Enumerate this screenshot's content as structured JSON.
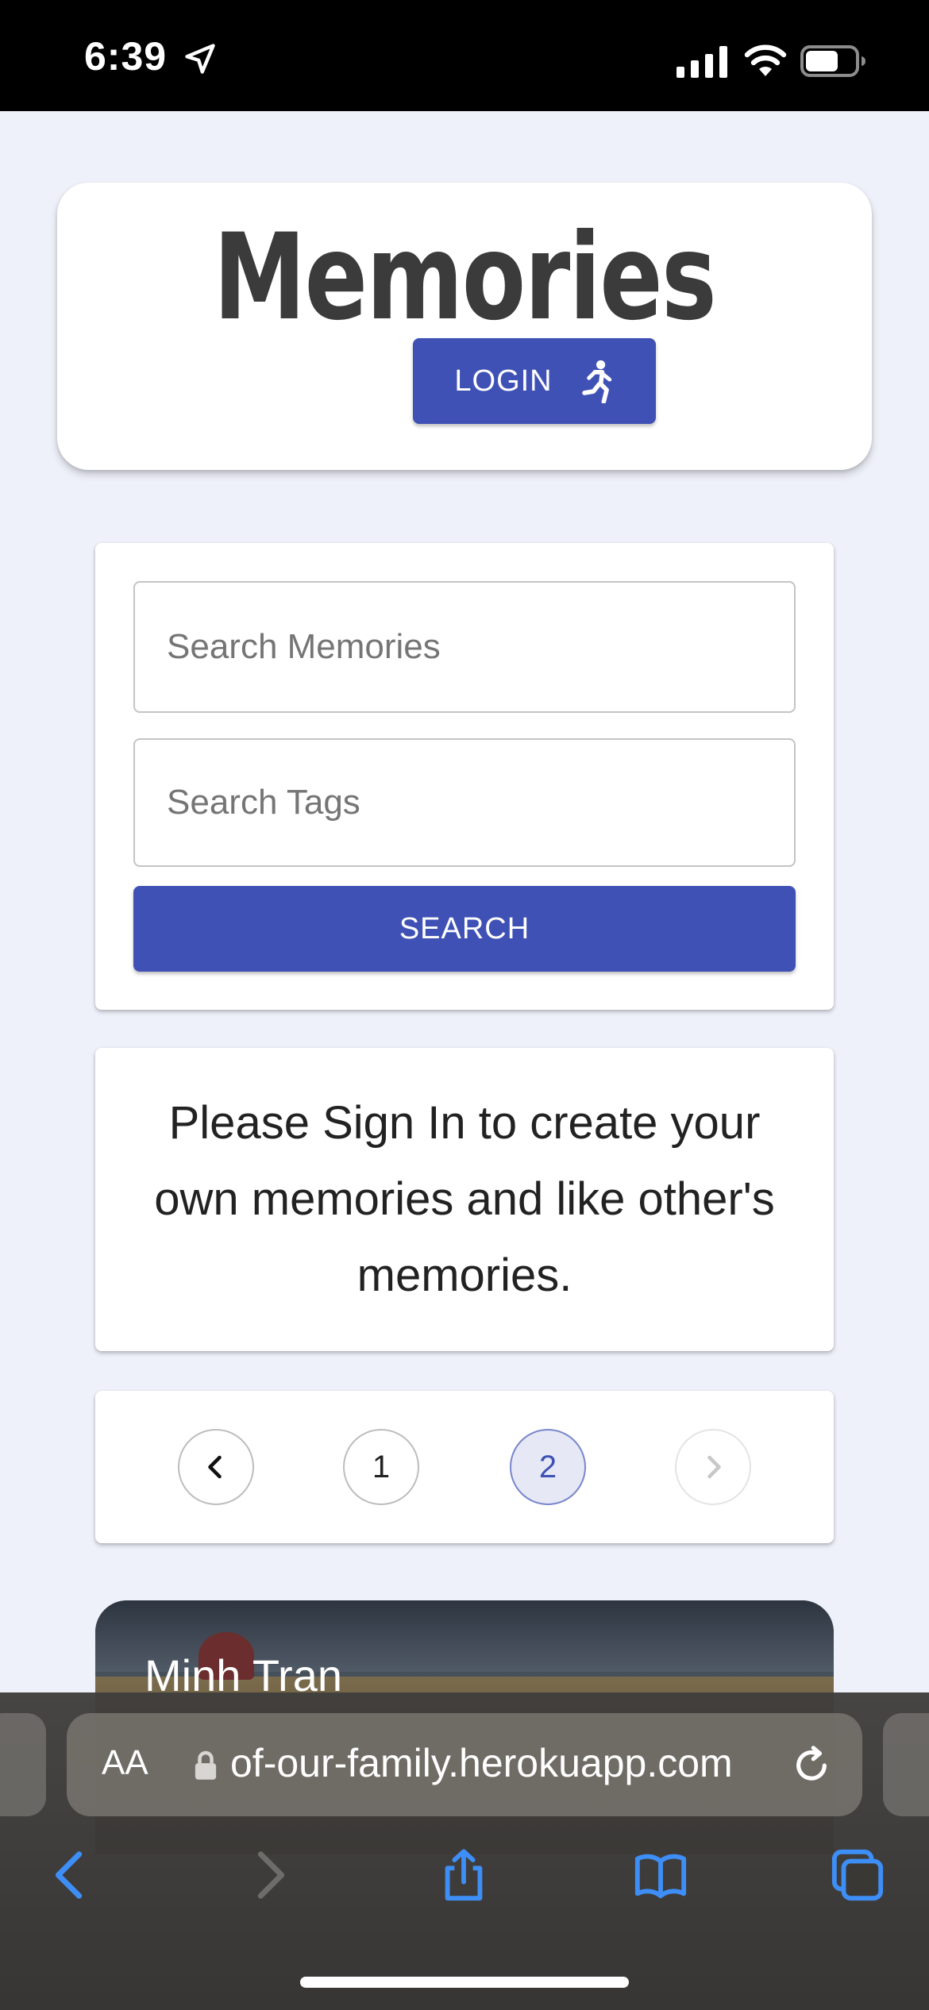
{
  "status_bar": {
    "time": "6:39",
    "icons": [
      "location-arrow-icon",
      "cellular-signal-icon",
      "wifi-icon",
      "battery-icon"
    ]
  },
  "header": {
    "brand": "Memories",
    "login_label": "LOGIN",
    "login_icon": "running-person-icon",
    "accent_color": "#3f51b5"
  },
  "search": {
    "memories_placeholder": "Search Memories",
    "tags_placeholder": "Search Tags",
    "button_label": "SEARCH"
  },
  "info": {
    "message": "Please Sign In to create your own memories and like other's memories."
  },
  "pagination": {
    "pages": [
      "1",
      "2"
    ],
    "current_page": "2",
    "prev_icon": "chevron-left-icon",
    "next_icon": "chevron-right-icon"
  },
  "memory_card": {
    "author": "Minh Tran"
  },
  "browser": {
    "text_size_label": "AA",
    "url": "of-our-family.herokuapp.com",
    "toolbar_icons": [
      "back-icon",
      "forward-icon",
      "share-icon",
      "bookmarks-icon",
      "tabs-icon"
    ]
  }
}
